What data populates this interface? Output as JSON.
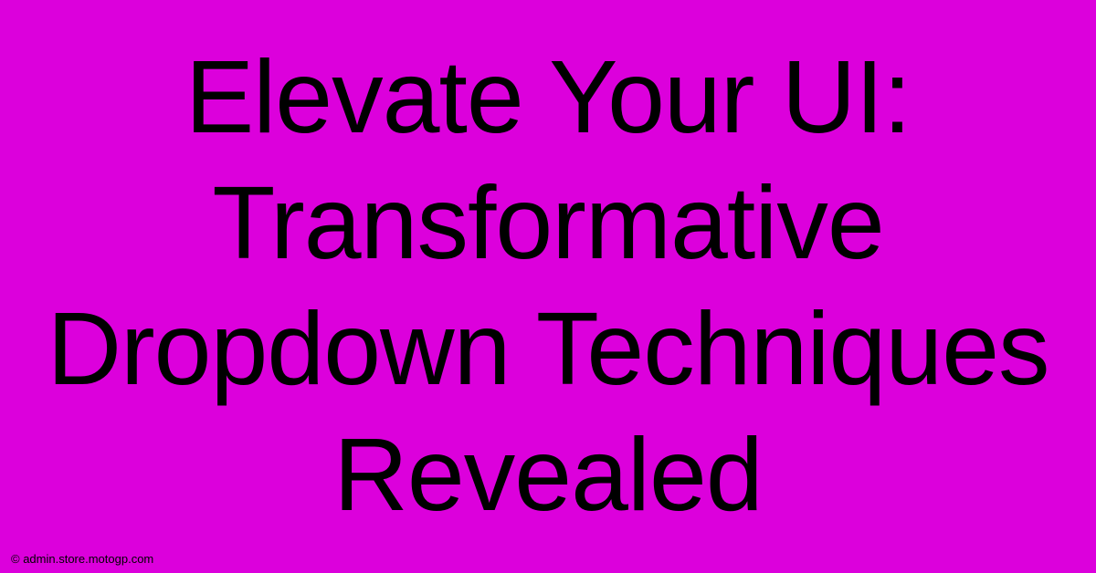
{
  "headline": "Elevate Your UI: Transformative Dropdown Techniques Revealed",
  "footer": "© admin.store.motogp.com",
  "colors": {
    "background": "#DC00DC",
    "text": "#000000"
  }
}
